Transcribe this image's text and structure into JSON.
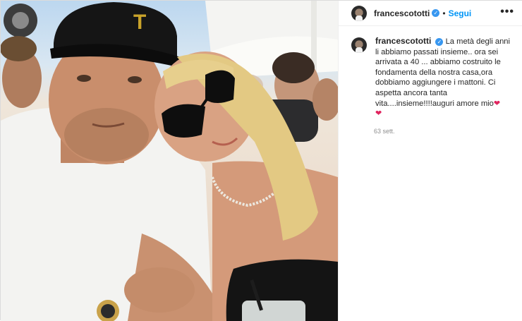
{
  "post": {
    "username": "francescototti",
    "verified_icon": "verified-badge-icon",
    "separator": "•",
    "follow_label": "Segui",
    "more_label": "•••",
    "caption_text": "La metà degli anni li abbiamo passati insieme.. ora sei arrivata a 40 ... abbiamo costruito le fondamenta della nostra casa,ora dobbiamo aggiungere i mattoni. Ci aspetta ancora tanta vita....insieme!!!!auguri amore mio",
    "heart_glyph": "❤",
    "timestamp": "63 sett."
  },
  "colors": {
    "accent": "#0095f6",
    "verified": "#3897f0",
    "heart": "#e0245e"
  },
  "photo": {
    "cap_logo": "T"
  }
}
